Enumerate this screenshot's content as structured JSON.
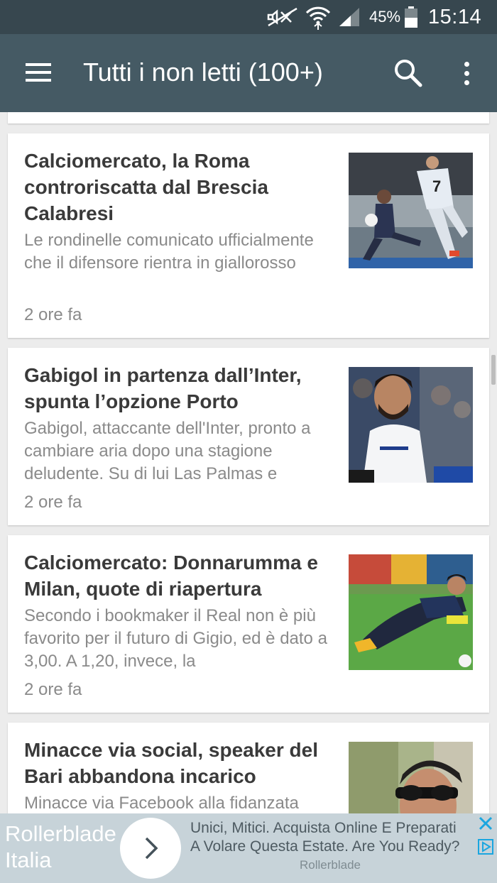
{
  "status_bar": {
    "battery": "45%",
    "time": "15:14",
    "icons": [
      "mute-icon",
      "wifi-icon",
      "signal-icon",
      "battery-icon"
    ]
  },
  "app_bar": {
    "title": "Tutti i non letti (100+)",
    "icons": [
      "menu-icon",
      "search-icon",
      "overflow-menu-icon"
    ]
  },
  "articles": [
    {
      "headline": "Calciomercato, la Roma controriscatta dal Brescia Calabresi",
      "snippet": "Le rondinelle comunicato ufficialmente che il difensore rientra in giallorosso",
      "age": "2 ore fa"
    },
    {
      "headline": "Gabigol in partenza dall’Inter, spunta l’opzione Porto",
      "snippet": "Gabigol, attaccante dell'Inter, pronto a cambiare aria dopo una stagione deludente. Su di lui Las Palmas e",
      "age": "2 ore fa"
    },
    {
      "headline": "Calciomercato: Donnarumma e Milan, quote di riapertura",
      "snippet": "Secondo i bookmaker il Real non è più favorito per il futuro di Gigio, ed è dato a 3,00. A 1,20, invece, la",
      "age": "2 ore fa"
    },
    {
      "headline": "Minacce via social, speaker del Bari abbandona incarico",
      "snippet": "Minacce via Facebook alla fidanzata",
      "age": ""
    }
  ],
  "ad": {
    "brand_line1": "Rollerblade",
    "brand_line2": "Italia",
    "text_line1": "Unici, Mitici. Acquista Online E Preparati",
    "text_line2": "A Volare Questa Estate. Are You Ready?",
    "advertiser": "Rollerblade",
    "icons": [
      "chevron-right-icon",
      "close-icon",
      "adchoices-icon"
    ]
  }
}
